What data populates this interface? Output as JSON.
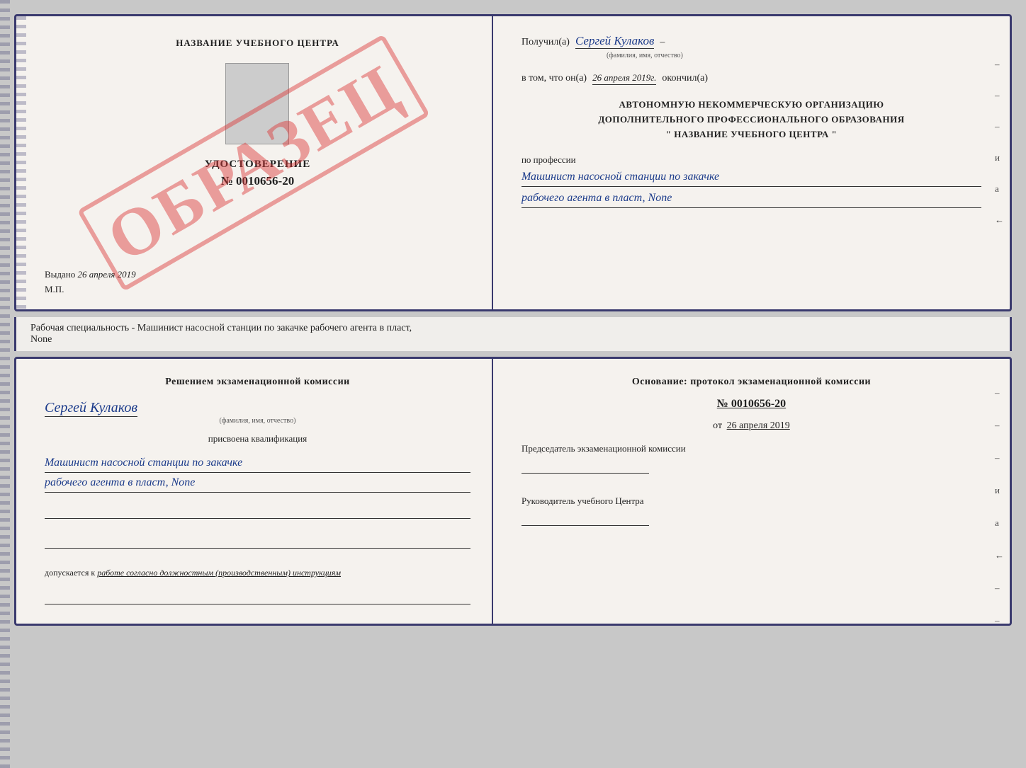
{
  "top_document": {
    "left": {
      "center_title": "НАЗВАНИЕ УЧЕБНОГО ЦЕНТРА",
      "watermark": "ОБРАЗЕЦ",
      "cert_title": "УДОСТОВЕРЕНИЕ",
      "cert_number": "№ 0010656-20",
      "issued_label": "Выдано",
      "issued_date": "26 апреля 2019",
      "mp_label": "М.П."
    },
    "right": {
      "received_label": "Получил(а)",
      "received_name": "Сергей Кулаков",
      "name_hint": "(фамилия, имя, отчество)",
      "date_label": "в том, что он(а)",
      "date_value": "26 апреля 2019г.",
      "finished_label": "окончил(а)",
      "org_line1": "АВТОНОМНУЮ НЕКОММЕРЧЕСКУЮ ОРГАНИЗАЦИЮ",
      "org_line2": "ДОПОЛНИТЕЛЬНОГО ПРОФЕССИОНАЛЬНОГО ОБРАЗОВАНИЯ",
      "org_line3": "\"   НАЗВАНИЕ УЧЕБНОГО ЦЕНТРА   \"",
      "profession_label": "по профессии",
      "profession_line1": "Машинист насосной станции по закачке",
      "profession_line2": "рабочего агента в пласт, None",
      "side_dashes": [
        "-",
        "-",
        "-",
        "и",
        "а",
        "←",
        "-",
        "-",
        "-"
      ]
    }
  },
  "separator": {
    "text": "Рабочая специальность - Машинист насосной станции по закачке рабочего агента в пласт,",
    "text2": "None"
  },
  "bottom_document": {
    "left": {
      "commission_title": "Решением  экзаменационной  комиссии",
      "person_name": "Сергей Кулаков",
      "name_hint": "(фамилия, имя, отчество)",
      "qualification_label": "присвоена квалификация",
      "qualification_line1": "Машинист насосной станции по закачке",
      "qualification_line2": "рабочего агента в пласт, None",
      "допускается_label": "допускается к",
      "допускается_value": "работе согласно должностным (производственным) инструкциям"
    },
    "right": {
      "osnov_title": "Основание:  протокол  экзаменационной  комиссии",
      "protocol_number": "№  0010656-20",
      "protocol_date_prefix": "от",
      "protocol_date": "26 апреля 2019",
      "chairman_label": "Председатель экзаменационной комиссии",
      "director_label": "Руководитель учебного Центра",
      "side_dashes": [
        "-",
        "-",
        "-",
        "и",
        "а",
        "←",
        "-",
        "-",
        "-"
      ]
    }
  }
}
